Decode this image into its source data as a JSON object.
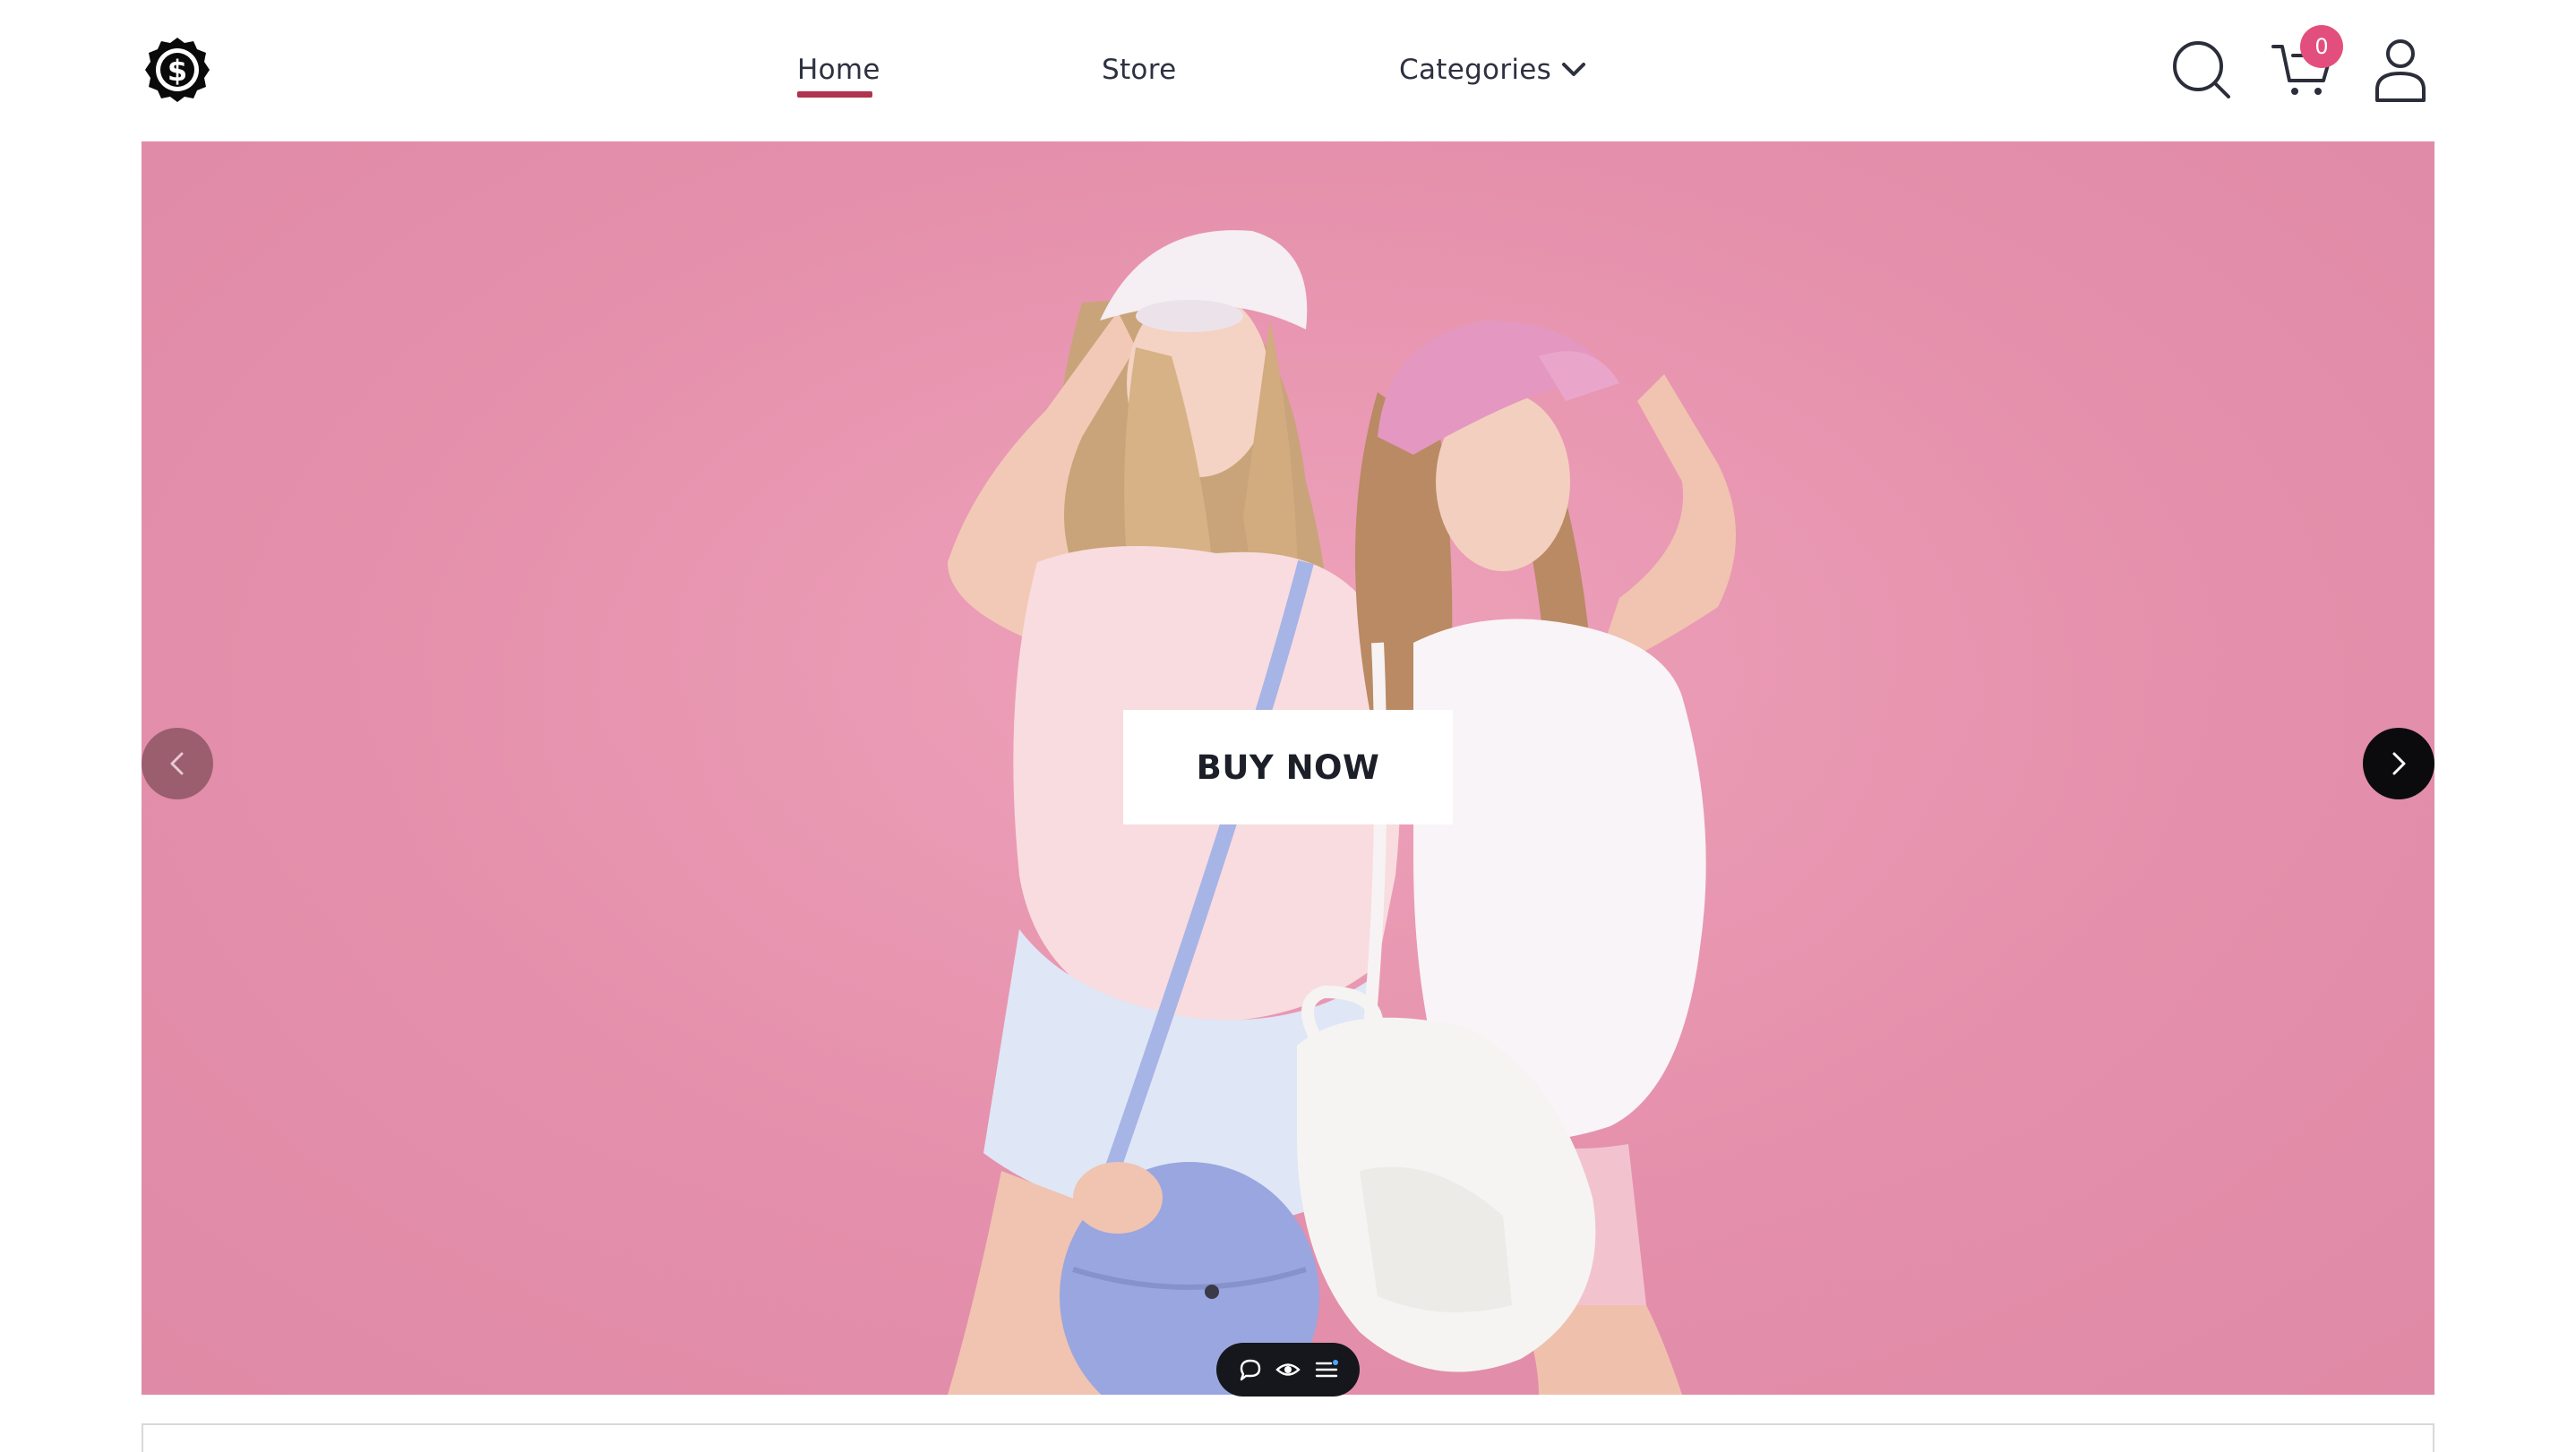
{
  "header": {
    "logo_icon": "dollar-badge-icon",
    "nav": {
      "home": "Home",
      "store": "Store",
      "categories": "Categories"
    },
    "active_nav": "Home",
    "active_color": "#b0344f",
    "icons": [
      "search-icon",
      "cart-icon",
      "user-icon"
    ],
    "cart_count": "0",
    "badge_color": "#e34f7d"
  },
  "hero": {
    "background_color": "#e48fab",
    "cta_label": "BUY NOW",
    "prev_icon": "chevron-left-icon",
    "next_icon": "chevron-right-icon"
  },
  "widget": {
    "icons": [
      "chat-icon",
      "eye-icon",
      "menu-icon"
    ]
  }
}
